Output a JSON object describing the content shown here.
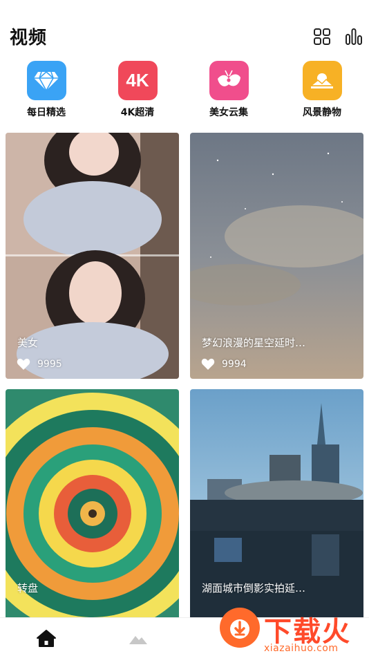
{
  "header": {
    "title": "视频",
    "grid_icon": "grid-icon",
    "stats_icon": "bar-chart-icon"
  },
  "categories": [
    {
      "label": "每日精选",
      "icon": "diamond-icon",
      "color": "#3aa3f5"
    },
    {
      "label": "4K超清",
      "icon": "4k-icon",
      "icon_text": "4K",
      "color": "#f0485a"
    },
    {
      "label": "美女云集",
      "icon": "butterfly-icon",
      "color": "#f04e8c"
    },
    {
      "label": "风景静物",
      "icon": "landscape-icon",
      "color": "#f7b125"
    }
  ],
  "videos": [
    {
      "title": "美女",
      "likes": "9995"
    },
    {
      "title": "梦幻浪漫的星空延时…",
      "likes": "9994"
    },
    {
      "title": "转盘",
      "likes": ""
    },
    {
      "title": "湖面城市倒影实拍延…",
      "likes": ""
    }
  ],
  "bottom_nav": [
    {
      "icon": "home-icon",
      "active": true
    },
    {
      "icon": "mountain-icon",
      "active": false
    }
  ],
  "watermark": {
    "big": "下载火",
    "small": "xiazaihuo.com"
  },
  "colors": {
    "accent": "#ff4a2a"
  }
}
